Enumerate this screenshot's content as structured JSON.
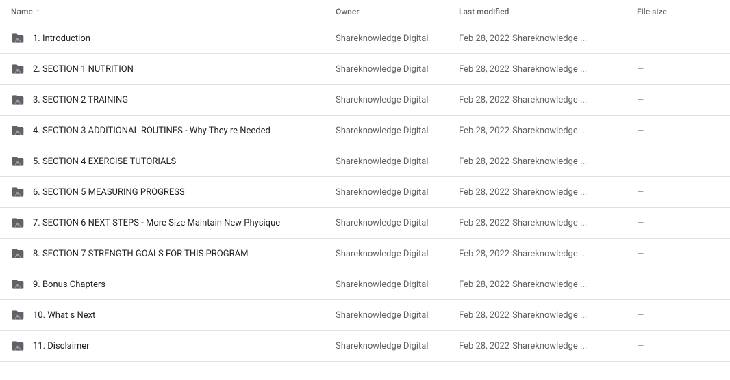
{
  "header": {
    "name_label": "Name",
    "owner_label": "Owner",
    "modified_label": "Last modified",
    "size_label": "File size"
  },
  "rows": [
    {
      "id": 1,
      "name": "1. Introduction",
      "owner": "Shareknowledge Digital",
      "modified_date": "Feb 28, 2022",
      "modified_user": "Shareknowledge ...",
      "size": "—"
    },
    {
      "id": 2,
      "name": "2. SECTION 1 NUTRITION",
      "owner": "Shareknowledge Digital",
      "modified_date": "Feb 28, 2022",
      "modified_user": "Shareknowledge ...",
      "size": "—"
    },
    {
      "id": 3,
      "name": "3. SECTION 2 TRAINING",
      "owner": "Shareknowledge Digital",
      "modified_date": "Feb 28, 2022",
      "modified_user": "Shareknowledge ...",
      "size": "—"
    },
    {
      "id": 4,
      "name": "4. SECTION 3 ADDITIONAL ROUTINES - Why They re Needed",
      "owner": "Shareknowledge Digital",
      "modified_date": "Feb 28, 2022",
      "modified_user": "Shareknowledge ...",
      "size": "—"
    },
    {
      "id": 5,
      "name": "5. SECTION 4 EXERCISE TUTORIALS",
      "owner": "Shareknowledge Digital",
      "modified_date": "Feb 28, 2022",
      "modified_user": "Shareknowledge ...",
      "size": "—"
    },
    {
      "id": 6,
      "name": "6. SECTION 5 MEASURING PROGRESS",
      "owner": "Shareknowledge Digital",
      "modified_date": "Feb 28, 2022",
      "modified_user": "Shareknowledge ...",
      "size": "—"
    },
    {
      "id": 7,
      "name": "7. SECTION 6 NEXT STEPS - More Size Maintain New Physique",
      "owner": "Shareknowledge Digital",
      "modified_date": "Feb 28, 2022",
      "modified_user": "Shareknowledge ...",
      "size": "—"
    },
    {
      "id": 8,
      "name": "8. SECTION 7 STRENGTH GOALS FOR THIS PROGRAM",
      "owner": "Shareknowledge Digital",
      "modified_date": "Feb 28, 2022",
      "modified_user": "Shareknowledge ...",
      "size": "—"
    },
    {
      "id": 9,
      "name": "9. Bonus Chapters",
      "owner": "Shareknowledge Digital",
      "modified_date": "Feb 28, 2022",
      "modified_user": "Shareknowledge ...",
      "size": "—"
    },
    {
      "id": 10,
      "name": "10. What s Next",
      "owner": "Shareknowledge Digital",
      "modified_date": "Feb 28, 2022",
      "modified_user": "Shareknowledge ...",
      "size": "—"
    },
    {
      "id": 11,
      "name": "11. Disclaimer",
      "owner": "Shareknowledge Digital",
      "modified_date": "Feb 28, 2022",
      "modified_user": "Shareknowledge ...",
      "size": "—"
    }
  ],
  "colors": {
    "folder_icon": "#5f6368",
    "folder_shared_badge": "#5f6368"
  }
}
